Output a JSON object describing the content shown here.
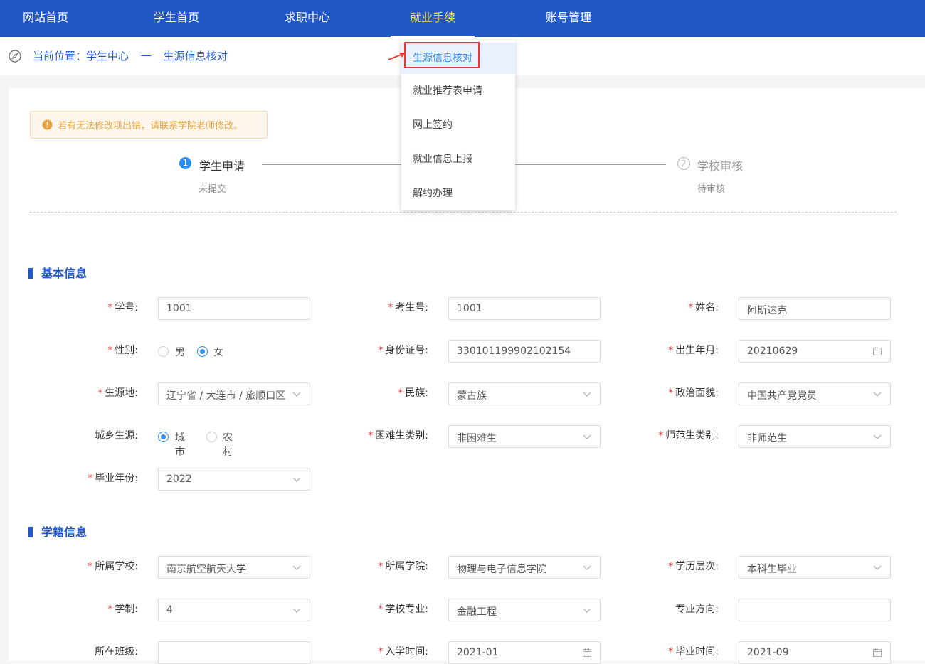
{
  "nav": {
    "items": [
      "网站首页",
      "学生首页",
      "求职中心",
      "就业手续",
      "账号管理"
    ],
    "active_index": 3
  },
  "breadcrumb": {
    "prefix": "当前位置：",
    "path": [
      "学生中心",
      "生源信息核对"
    ],
    "separator": "一"
  },
  "notice": "若有无法修改项出错，请联系学院老师修改。",
  "steps": [
    {
      "num": "1",
      "title": "学生申请",
      "status": "未提交"
    },
    {
      "num": "2",
      "title": "学校审核",
      "status": "待审核"
    }
  ],
  "dropdown": {
    "items": [
      "生源信息核对",
      "就业推荐表申请",
      "网上签约",
      "就业信息上报",
      "解约办理"
    ],
    "selected_index": 0
  },
  "sections": {
    "basic": "基本信息",
    "school": "学籍信息"
  },
  "form": {
    "student_no": {
      "label": "学号",
      "value": "1001"
    },
    "exam_no": {
      "label": "考生号",
      "value": "1001"
    },
    "name": {
      "label": "姓名",
      "value": "阿斯达克"
    },
    "gender": {
      "label": "性别",
      "options": [
        "男",
        "女"
      ],
      "selected": "女"
    },
    "id_no": {
      "label": "身份证号",
      "value": "330101199902102154"
    },
    "birth": {
      "label": "出生年月",
      "value": "20210629"
    },
    "origin": {
      "label": "生源地",
      "value": "辽宁省 / 大连市 / 旅顺口区"
    },
    "ethnic": {
      "label": "民族",
      "value": "蒙古族"
    },
    "political": {
      "label": "政治面貌",
      "value": "中国共产党党员"
    },
    "urban": {
      "label": "城乡生源",
      "options": [
        "城市",
        "农村"
      ],
      "selected": "城市"
    },
    "difficulty": {
      "label": "困难生类别",
      "value": "非困难生"
    },
    "normal": {
      "label": "师范生类别",
      "value": "非师范生"
    },
    "grad_year": {
      "label": "毕业年份",
      "value": "2022"
    },
    "school": {
      "label": "所属学校",
      "value": "南京航空航天大学"
    },
    "college": {
      "label": "所属学院",
      "value": "物理与电子信息学院"
    },
    "level": {
      "label": "学历层次",
      "value": "本科生毕业"
    },
    "duration": {
      "label": "学制",
      "value": "4"
    },
    "major": {
      "label": "学校专业",
      "value": "金融工程"
    },
    "direction": {
      "label": "专业方向",
      "value": ""
    },
    "class": {
      "label": "所在班级",
      "value": ""
    },
    "enroll": {
      "label": "入学时间",
      "value": "2021-01"
    },
    "graduate": {
      "label": "毕业时间",
      "value": "2021-09"
    }
  },
  "colors": {
    "nav_bg": "#2158c6",
    "accent": "#2d8cf0",
    "active_nav": "#ffe14a",
    "required": "#e4393c",
    "highlight_box": "#e53935"
  }
}
